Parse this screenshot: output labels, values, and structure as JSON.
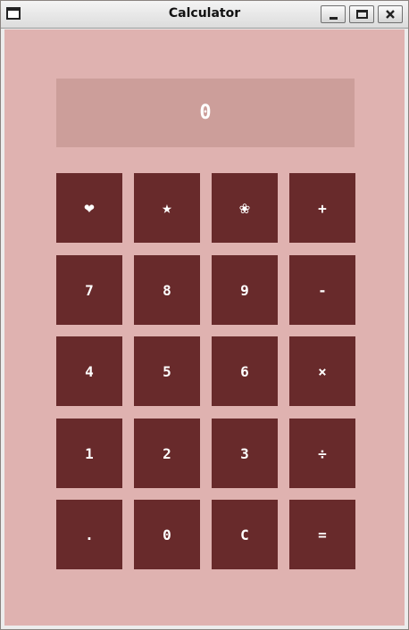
{
  "window": {
    "title": "Calculator",
    "controls": {
      "minimize": "_",
      "maximize": "□",
      "close": "X"
    }
  },
  "display": {
    "value": "0"
  },
  "keys": [
    [
      "❤",
      "★",
      "❀",
      "+"
    ],
    [
      "7",
      "8",
      "9",
      "-"
    ],
    [
      "4",
      "5",
      "6",
      "×"
    ],
    [
      "1",
      "2",
      "3",
      "÷"
    ],
    [
      ".",
      "0",
      "C",
      "="
    ]
  ],
  "colors": {
    "background": "#dfb2b0",
    "display": "#cc9e9a",
    "key": "#682a2b",
    "key_text": "#ffffff"
  }
}
